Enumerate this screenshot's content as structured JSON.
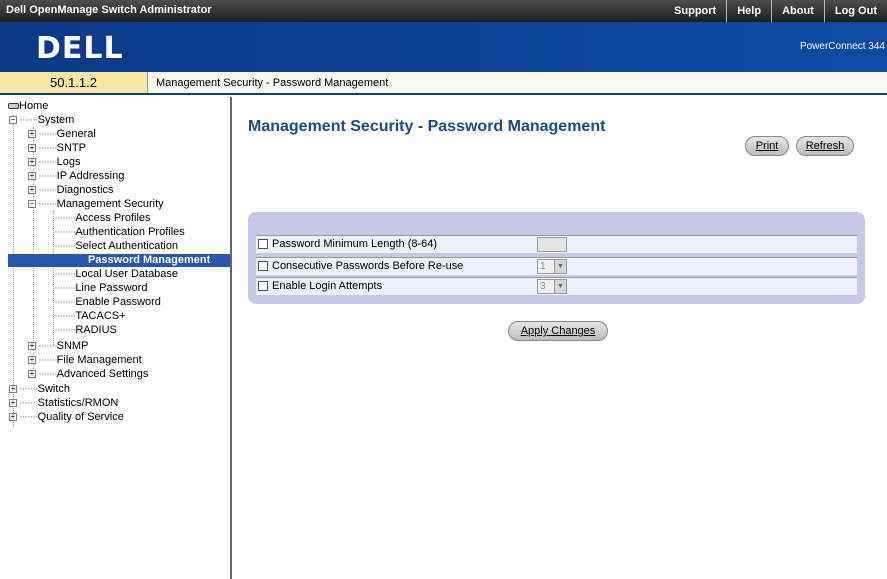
{
  "header": {
    "app_title": "Dell OpenManage Switch Administrator",
    "links": [
      "Support",
      "Help",
      "About",
      "Log Out"
    ]
  },
  "banner": {
    "logo_text": "DELL",
    "product": "PowerConnect 344"
  },
  "address": {
    "ip": "50.1.1.2",
    "path": "Management Security - Password Management"
  },
  "tree": {
    "home": "Home",
    "system": "System",
    "general": "General",
    "sntp": "SNTP",
    "logs": "Logs",
    "ip_addressing": "IP Addressing",
    "diagnostics": "Diagnostics",
    "mgmt_security": "Management Security",
    "access_profiles": "Access Profiles",
    "auth_profiles": "Authentication Profiles",
    "select_auth": "Select Authentication",
    "password_mgmt": "Password Management",
    "local_user_db": "Local User Database",
    "line_password": "Line Password",
    "enable_password": "Enable Password",
    "tacacs": "TACACS+",
    "radius": "RADIUS",
    "snmp": "SNMP",
    "file_mgmt": "File Management",
    "advanced": "Advanced Settings",
    "switch": "Switch",
    "stats": "Statistics/RMON",
    "qos": "Quality of Service"
  },
  "main": {
    "title": "Management Security - Password Management",
    "print_label": "Print",
    "refresh_label": "Refresh",
    "apply_label": "Apply Changes",
    "rows": [
      {
        "label": "Password Minimum Length (8-64)",
        "value": ""
      },
      {
        "label": "Consecutive Passwords Before Re-use",
        "value": "1"
      },
      {
        "label": "Enable Login Attempts",
        "value": "3"
      }
    ]
  },
  "colors": {
    "banner": "#0b3f8f",
    "title": "#1d4a8c",
    "selected": "#2855b3",
    "panel": "#c6c9e6"
  }
}
